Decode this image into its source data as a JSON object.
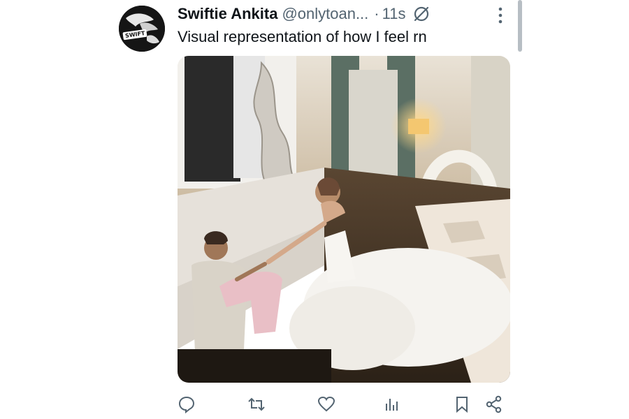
{
  "tweet": {
    "display_name": "Swiftie Ankita",
    "handle": "@onlytoan...",
    "separator": "·",
    "time": "11s",
    "text": "Visual representation of how I feel rn",
    "avatar_text": "SWIFT"
  },
  "icons": {
    "mute": "muted-notifications-icon",
    "more": "more-options-icon",
    "reply": "reply-icon",
    "retweet": "retweet-icon",
    "like": "like-icon",
    "views": "views-icon",
    "bookmark": "bookmark-icon",
    "share": "share-icon"
  },
  "colors": {
    "text": "#0f1419",
    "secondary": "#536471",
    "icon": "#536471"
  }
}
